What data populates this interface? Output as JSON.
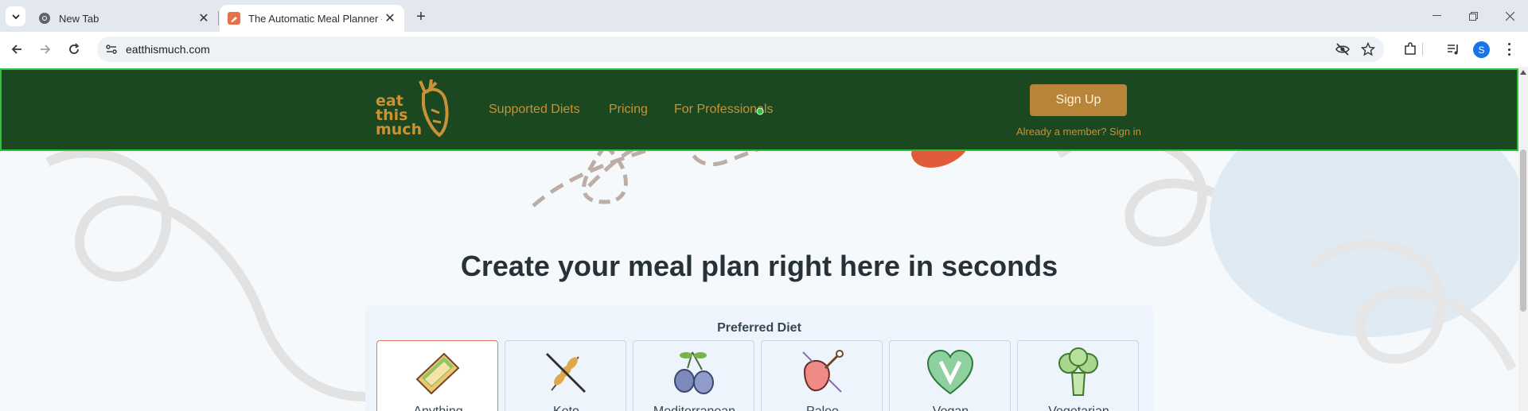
{
  "browser": {
    "tabs": [
      {
        "title": "New Tab",
        "active": false
      },
      {
        "title": "The Automatic Meal Planner - Eat This Much",
        "active": true
      }
    ],
    "url": "eatthismuch.com",
    "profile_initial": "S"
  },
  "site": {
    "logo_lines": [
      "eat",
      "this",
      "much"
    ],
    "nav": [
      "Supported Diets",
      "Pricing",
      "For Professionals"
    ],
    "signup_label": "Sign Up",
    "signin_label": "Already a member? Sign in"
  },
  "hero": {
    "headline": "Create your meal plan right here in seconds"
  },
  "diet_selector": {
    "title": "Preferred Diet",
    "options": [
      {
        "label": "Anything",
        "icon": "sandwich-icon",
        "selected": true
      },
      {
        "label": "Keto",
        "icon": "wheat-crossed-icon",
        "selected": false
      },
      {
        "label": "Mediterranean",
        "icon": "olives-icon",
        "selected": false
      },
      {
        "label": "Paleo",
        "icon": "meat-icon",
        "selected": false
      },
      {
        "label": "Vegan",
        "icon": "heart-v-icon",
        "selected": false
      },
      {
        "label": "Vegetarian",
        "icon": "broccoli-icon",
        "selected": false
      }
    ]
  },
  "colors": {
    "header_bg": "#1b4721",
    "brand_gold": "#c99234",
    "button_bg": "#b7843a",
    "selected_border": "#e07a5f"
  }
}
